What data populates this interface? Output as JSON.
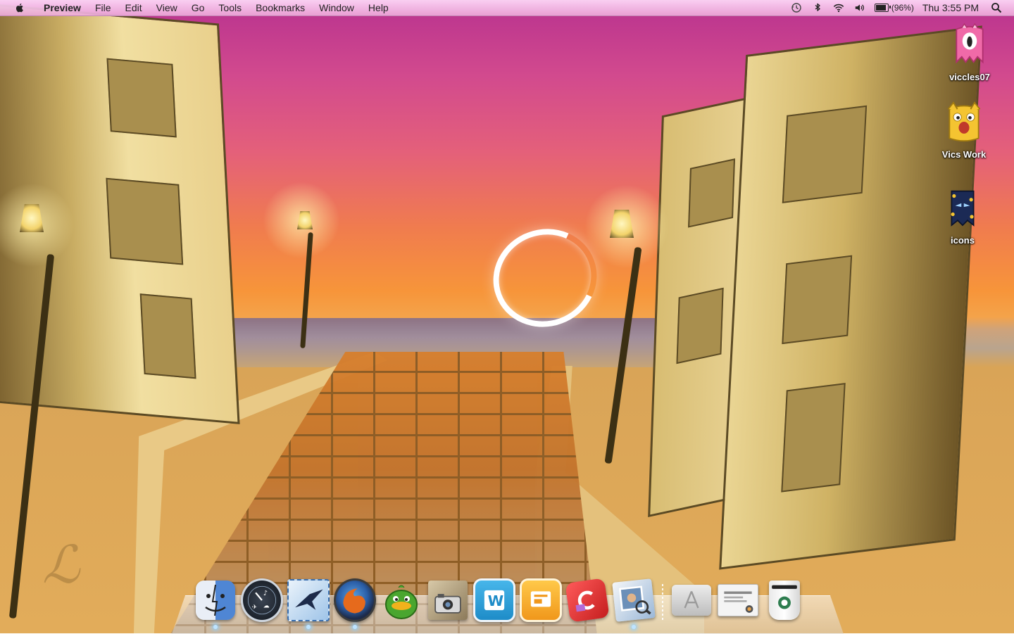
{
  "menubar": {
    "app_name": "Preview",
    "items": [
      "File",
      "Edit",
      "View",
      "Go",
      "Tools",
      "Bookmarks",
      "Window",
      "Help"
    ],
    "status": {
      "icons": [
        "time-machine-icon",
        "bluetooth-icon",
        "wifi-icon",
        "volume-icon"
      ],
      "battery_percent": 96,
      "battery_text": "(96%)",
      "clock": "Thu 3:55 PM",
      "search_icon": "spotlight-icon"
    }
  },
  "desktop": {
    "icons": [
      {
        "label": "viccles07",
        "icon": "pink-monster-icon",
        "color": "#f06aa8"
      },
      {
        "label": "Vics Work",
        "icon": "yellow-monster-icon",
        "color": "#f4c431"
      },
      {
        "label": "icons",
        "icon": "dark-blue-monster-icon",
        "color": "#1b2a55"
      }
    ]
  },
  "dock": {
    "apps": [
      {
        "name": "Finder",
        "icon": "finder-icon",
        "running": true,
        "color": "#5c8fd6"
      },
      {
        "name": "Dashboard",
        "icon": "dashboard-icon",
        "running": false,
        "color": "#2e3440"
      },
      {
        "name": "Mail",
        "icon": "mail-icon",
        "running": true,
        "color": "#2f6fc4"
      },
      {
        "name": "Firefox",
        "icon": "firefox-icon",
        "running": true,
        "color": "#e66a1c"
      },
      {
        "name": "Adium",
        "icon": "adium-duck-icon",
        "running": false,
        "color": "#4aa62f"
      },
      {
        "name": "iPhoto",
        "icon": "iphoto-icon",
        "running": false,
        "color": "#8c7a5a"
      },
      {
        "name": "Word",
        "icon": "word-icon",
        "running": false,
        "color": "#2aa0d8"
      },
      {
        "name": "Keynote",
        "icon": "presentation-icon",
        "running": false,
        "color": "#f0a21b"
      },
      {
        "name": "Camino",
        "icon": "red-cube-app-icon",
        "running": false,
        "color": "#d93030"
      },
      {
        "name": "Preview",
        "icon": "preview-icon",
        "running": true,
        "color": "#9bb8d8"
      }
    ],
    "stacks": [
      {
        "name": "Applications",
        "icon": "applications-folder-icon",
        "color": "#c9c9c9"
      },
      {
        "name": "Documents",
        "icon": "documents-stack-icon",
        "color": "#e8e8e8"
      },
      {
        "name": "Trash",
        "icon": "coffee-cup-trash-icon",
        "color": "#2e7d4f"
      }
    ]
  }
}
